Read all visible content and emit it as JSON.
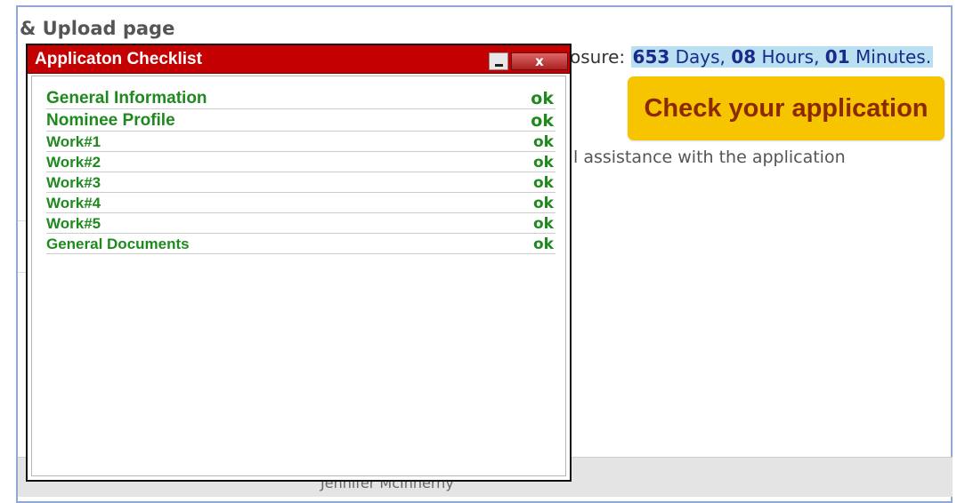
{
  "page": {
    "heading": "& Upload page",
    "countdown": {
      "prefix": "osure:",
      "days": "653",
      "days_label": "Days,",
      "hours": "08",
      "hours_label": "Hours,",
      "minutes": "01",
      "minutes_label": "Minutes."
    },
    "check_button_label": "Check your application",
    "assistance_text": "l assistance with the application",
    "footer_text": "Jennifer McInnerny"
  },
  "dialog": {
    "title": "Applicaton Checklist",
    "close_label": "x",
    "items": [
      {
        "label": "General Information",
        "status": "ok"
      },
      {
        "label": "Nominee Profile",
        "status": "ok"
      },
      {
        "label": "Work#1",
        "status": "ok"
      },
      {
        "label": "Work#2",
        "status": "ok"
      },
      {
        "label": "Work#3",
        "status": "ok"
      },
      {
        "label": "Work#4",
        "status": "ok"
      },
      {
        "label": "Work#5",
        "status": "ok"
      },
      {
        "label": "General Documents",
        "status": "ok"
      }
    ]
  },
  "colors": {
    "titlebar": "#c40000",
    "ok_green": "#1e8a1e",
    "button_yellow": "#f7c400",
    "button_text": "#8b2a00"
  }
}
